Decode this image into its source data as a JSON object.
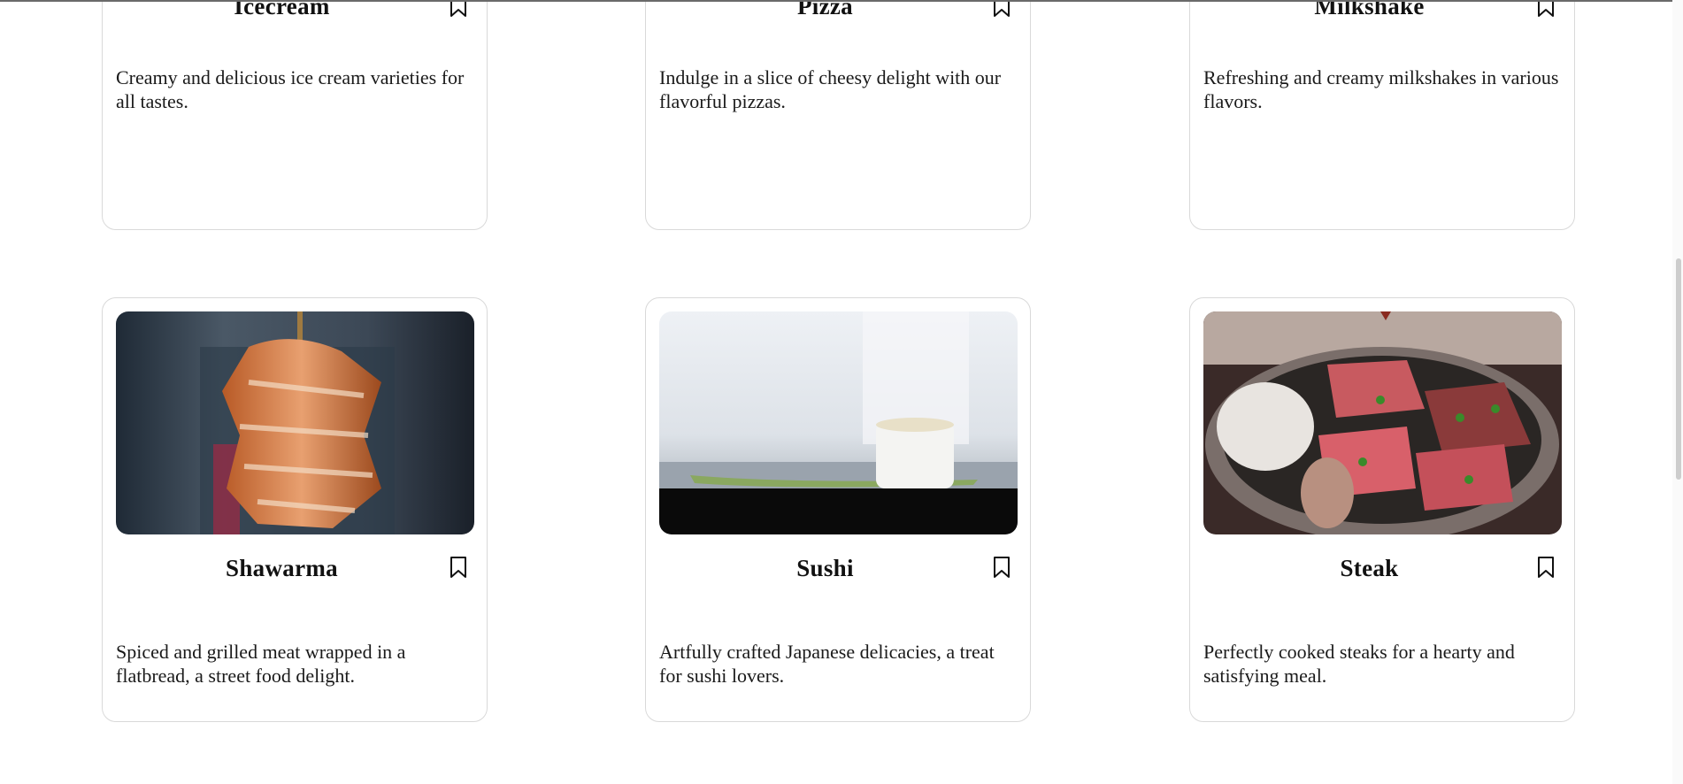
{
  "cards": [
    {
      "title": "Icecream",
      "description": "Creamy and delicious ice cream varieties for all tastes.",
      "icon": "bookmark-icon"
    },
    {
      "title": "Pizza",
      "description": "Indulge in a slice of cheesy delight with our flavorful pizzas.",
      "icon": "bookmark-icon"
    },
    {
      "title": "Milkshake",
      "description": "Refreshing and creamy milkshakes in various flavors.",
      "icon": "bookmark-icon"
    },
    {
      "title": "Shawarma",
      "description": "Spiced and grilled meat wrapped in a flatbread, a street food delight.",
      "icon": "bookmark-icon"
    },
    {
      "title": "Sushi",
      "description": "Artfully crafted Japanese delicacies, a treat for sushi lovers.",
      "icon": "bookmark-icon"
    },
    {
      "title": "Steak",
      "description": "Perfectly cooked steaks for a hearty and satisfying meal.",
      "icon": "bookmark-icon"
    }
  ]
}
